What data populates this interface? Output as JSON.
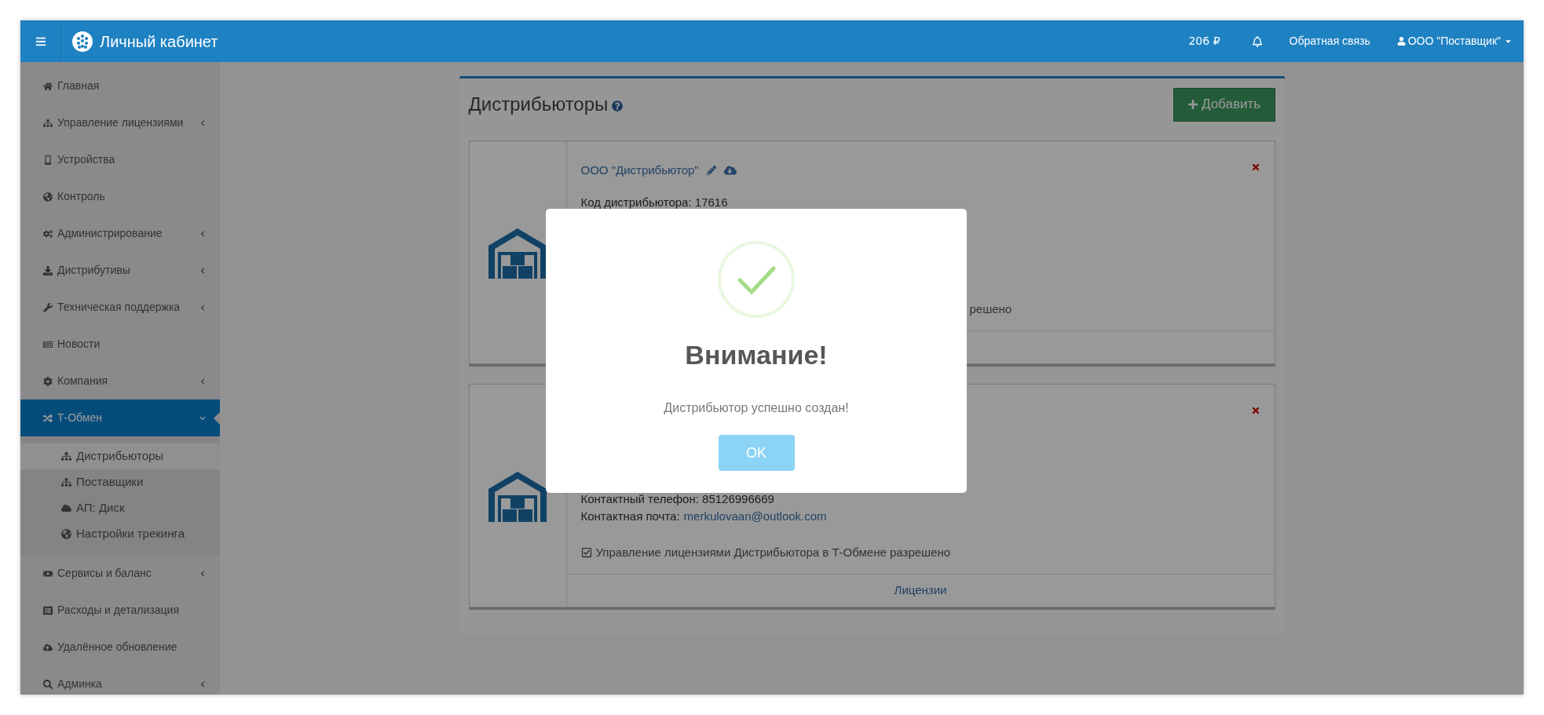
{
  "header": {
    "title": "Личный кабинет",
    "balance": "206 ₽",
    "feedback": "Обратная связь",
    "user": "ООО \"Поставщик\""
  },
  "sidebar": {
    "items": [
      {
        "label": "Главная",
        "selected": false
      },
      {
        "label": "Управление лицензиями",
        "expanded": false,
        "selected": false
      },
      {
        "label": "Устройства",
        "selected": false
      },
      {
        "label": "Контроль",
        "selected": false
      },
      {
        "label": "Администрирование",
        "expanded": false,
        "selected": false
      },
      {
        "label": "Дистрибутивы",
        "expanded": false,
        "selected": false
      },
      {
        "label": "Техническая поддержка",
        "expanded": false,
        "selected": false
      },
      {
        "label": "Новости",
        "selected": false
      },
      {
        "label": "Компания",
        "expanded": false,
        "selected": false
      },
      {
        "label": "Т-Обмен",
        "expanded": true,
        "selected": true,
        "children": [
          {
            "label": "Дистрибьюторы",
            "selected": true
          },
          {
            "label": "Поставщики",
            "selected": false
          },
          {
            "label": "АП: Диск",
            "selected": false
          },
          {
            "label": "Настройки трекинга",
            "selected": false
          }
        ]
      },
      {
        "label": "Сервисы и баланс",
        "expanded": false,
        "selected": false
      },
      {
        "label": "Расходы и детализация",
        "selected": false
      },
      {
        "label": "Удалённое обновление",
        "selected": false
      },
      {
        "label": "Админка",
        "expanded": false,
        "selected": false
      }
    ]
  },
  "panel": {
    "title": "Дистрибьюторы",
    "add_button": "Добавить",
    "cards": [
      {
        "name": "ООО \"Дистрибьютор\"",
        "code": "Код дистрибьютора: 17616",
        "permission_fragment": "решено"
      },
      {
        "phone": "Контактный телефон: 85126996669",
        "email_label": "Контактная почта:",
        "email": "merkulovaan@outlook.com",
        "permission": {
          "label": "Управление лицензиями Дистрибьютора в Т-Обмене разрешено",
          "checked": true
        },
        "footer_link": "Лицензии"
      }
    ]
  },
  "modal": {
    "title": "Внимание!",
    "message": "Дистрибьютор успешно создан!",
    "button": "OK"
  }
}
